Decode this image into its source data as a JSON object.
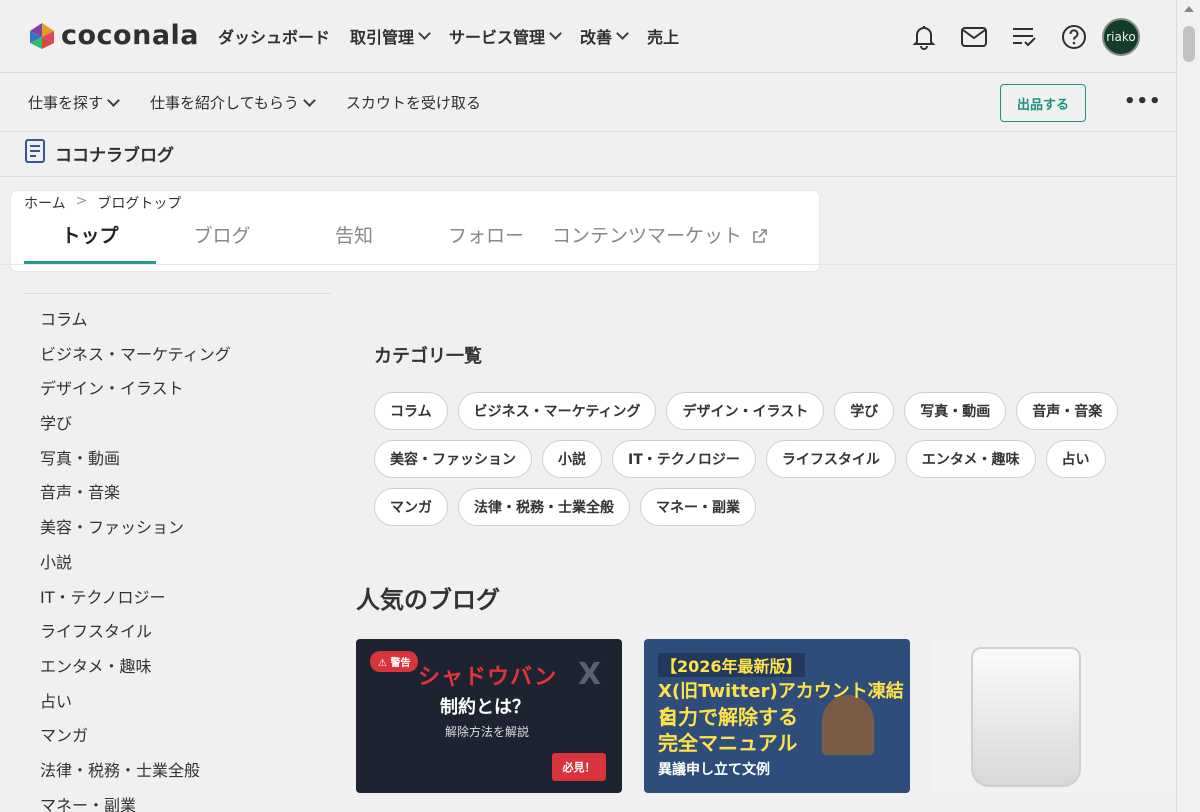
{
  "header": {
    "logo_text": "coconala",
    "nav": [
      {
        "label": "ダッシュボード",
        "dropdown": false
      },
      {
        "label": "取引管理",
        "dropdown": true
      },
      {
        "label": "サービス管理",
        "dropdown": true
      },
      {
        "label": "改善",
        "dropdown": true
      },
      {
        "label": "売上",
        "dropdown": false
      }
    ],
    "icons": [
      "bell-icon",
      "mail-icon",
      "checklist-icon",
      "help-icon"
    ],
    "avatar_text": "riako"
  },
  "subheader": {
    "nav": [
      {
        "label": "仕事を探す",
        "dropdown": true
      },
      {
        "label": "仕事を紹介してもらう",
        "dropdown": true
      },
      {
        "label": "スカウトを受け取る",
        "dropdown": false
      }
    ],
    "sell_button": "出品する",
    "more_label": "•••"
  },
  "blog": {
    "title": "ココナラブログ",
    "breadcrumb": [
      "ホーム",
      "ブログトップ"
    ],
    "breadcrumb_sep": ">",
    "tabs": [
      "トップ",
      "ブログ",
      "告知",
      "フォロー",
      "コンテンツマーケット"
    ],
    "active_tab": 0
  },
  "sidebar": {
    "items": [
      "コラム",
      "ビジネス・マーケティング",
      "デザイン・イラスト",
      "学び",
      "写真・動画",
      "音声・音楽",
      "美容・ファッション",
      "小説",
      "IT・テクノロジー",
      "ライフスタイル",
      "エンタメ・趣味",
      "占い",
      "マンガ",
      "法律・税務・士業全般",
      "マネー・副業"
    ]
  },
  "categories": {
    "title": "カテゴリ一覧",
    "chips": [
      "コラム",
      "ビジネス・マーケティング",
      "デザイン・イラスト",
      "学び",
      "写真・動画",
      "音声・音楽",
      "美容・ファッション",
      "小説",
      "IT・テクノロジー",
      "ライフスタイル",
      "エンタメ・趣味",
      "占い",
      "マンガ",
      "法律・税務・士業全般",
      "マネー・副業"
    ]
  },
  "popular": {
    "title": "人気のブログ",
    "cards": [
      {
        "badge": "警告",
        "line1": "シャドウバン",
        "line2": "制約とは？",
        "line3": "解除方法を解説",
        "button": "必見！"
      },
      {
        "line1": "【2026年最新版】",
        "line2": "X(旧Twitter)アカウント凍結を",
        "line3": "自力で解除する",
        "line4": "完全マニュアル",
        "line5": "異議申し立て文例"
      },
      {}
    ]
  },
  "colors": {
    "accent": "#1e9c8e",
    "warning": "#d8343c"
  }
}
